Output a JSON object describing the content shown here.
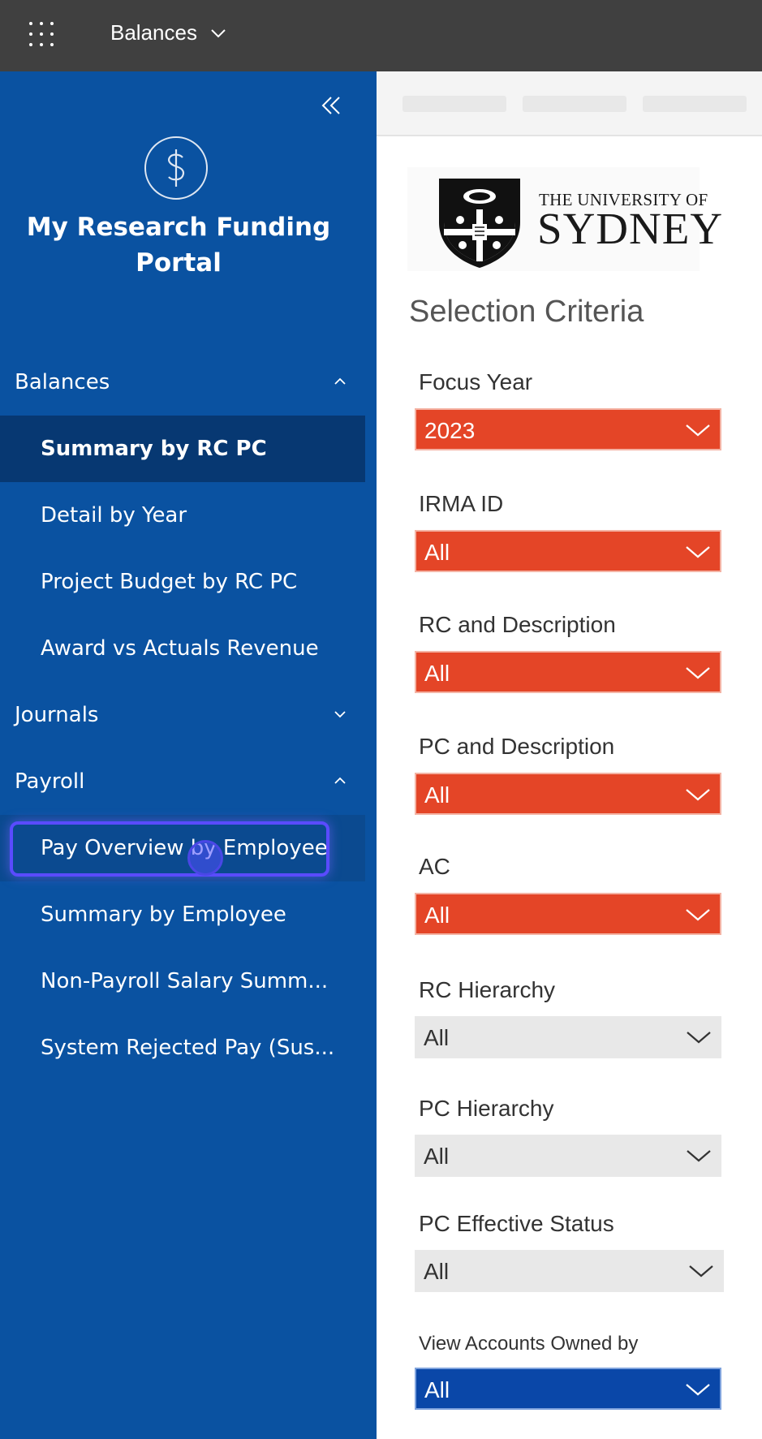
{
  "topbar": {
    "title": "Balances"
  },
  "sidebar": {
    "portal_title": "My Research Funding Portal",
    "items": [
      {
        "label": "Balances",
        "type": "section",
        "expanded": true
      },
      {
        "label": "Summary by RC PC",
        "type": "sub",
        "active": true
      },
      {
        "label": "Detail by Year",
        "type": "sub"
      },
      {
        "label": "Project Budget by RC PC",
        "type": "sub"
      },
      {
        "label": "Award vs Actuals Revenue",
        "type": "sub"
      },
      {
        "label": "Journals",
        "type": "section",
        "expanded": false
      },
      {
        "label": "Payroll",
        "type": "section",
        "expanded": true
      },
      {
        "label": "Pay Overview by Employee",
        "type": "sub",
        "focused": true
      },
      {
        "label": "Summary by Employee",
        "type": "sub"
      },
      {
        "label": "Non-Payroll Salary Summ...",
        "type": "sub"
      },
      {
        "label": "System Rejected Pay (Sus...",
        "type": "sub"
      }
    ]
  },
  "main": {
    "logo": {
      "line1": "THE UNIVERSITY OF",
      "line2": "SYDNEY"
    },
    "section_heading": "Selection Criteria",
    "filters": [
      {
        "label": "Focus Year",
        "value": "2023",
        "style": "orange"
      },
      {
        "label": "IRMA ID",
        "value": "All",
        "style": "orange"
      },
      {
        "label": "RC and Description",
        "value": "All",
        "style": "orange"
      },
      {
        "label": "PC and Description",
        "value": "All",
        "style": "orange"
      },
      {
        "label": "AC",
        "value": "All",
        "style": "orange"
      },
      {
        "label": "RC Hierarchy",
        "value": "All",
        "style": "grey"
      },
      {
        "label": "PC Hierarchy",
        "value": "All",
        "style": "grey"
      },
      {
        "label": "PC Effective Status",
        "value": "All",
        "style": "grey"
      },
      {
        "label": "View Accounts Owned by",
        "value": "All",
        "style": "blue"
      }
    ]
  },
  "colors": {
    "sidebar_bg": "#0a52a1",
    "sidebar_active": "#073872",
    "topbar_bg": "#404040",
    "filter_orange": "#e44527",
    "filter_grey": "#e8e8e8",
    "filter_blue": "#0a47a8",
    "focus_ring": "#5a4bff"
  },
  "icons": [
    "app-launcher-icon",
    "chevron-down-icon",
    "collapse-double-chevron-icon",
    "dollar-icon",
    "chevron-up-icon",
    "university-crest-icon"
  ]
}
